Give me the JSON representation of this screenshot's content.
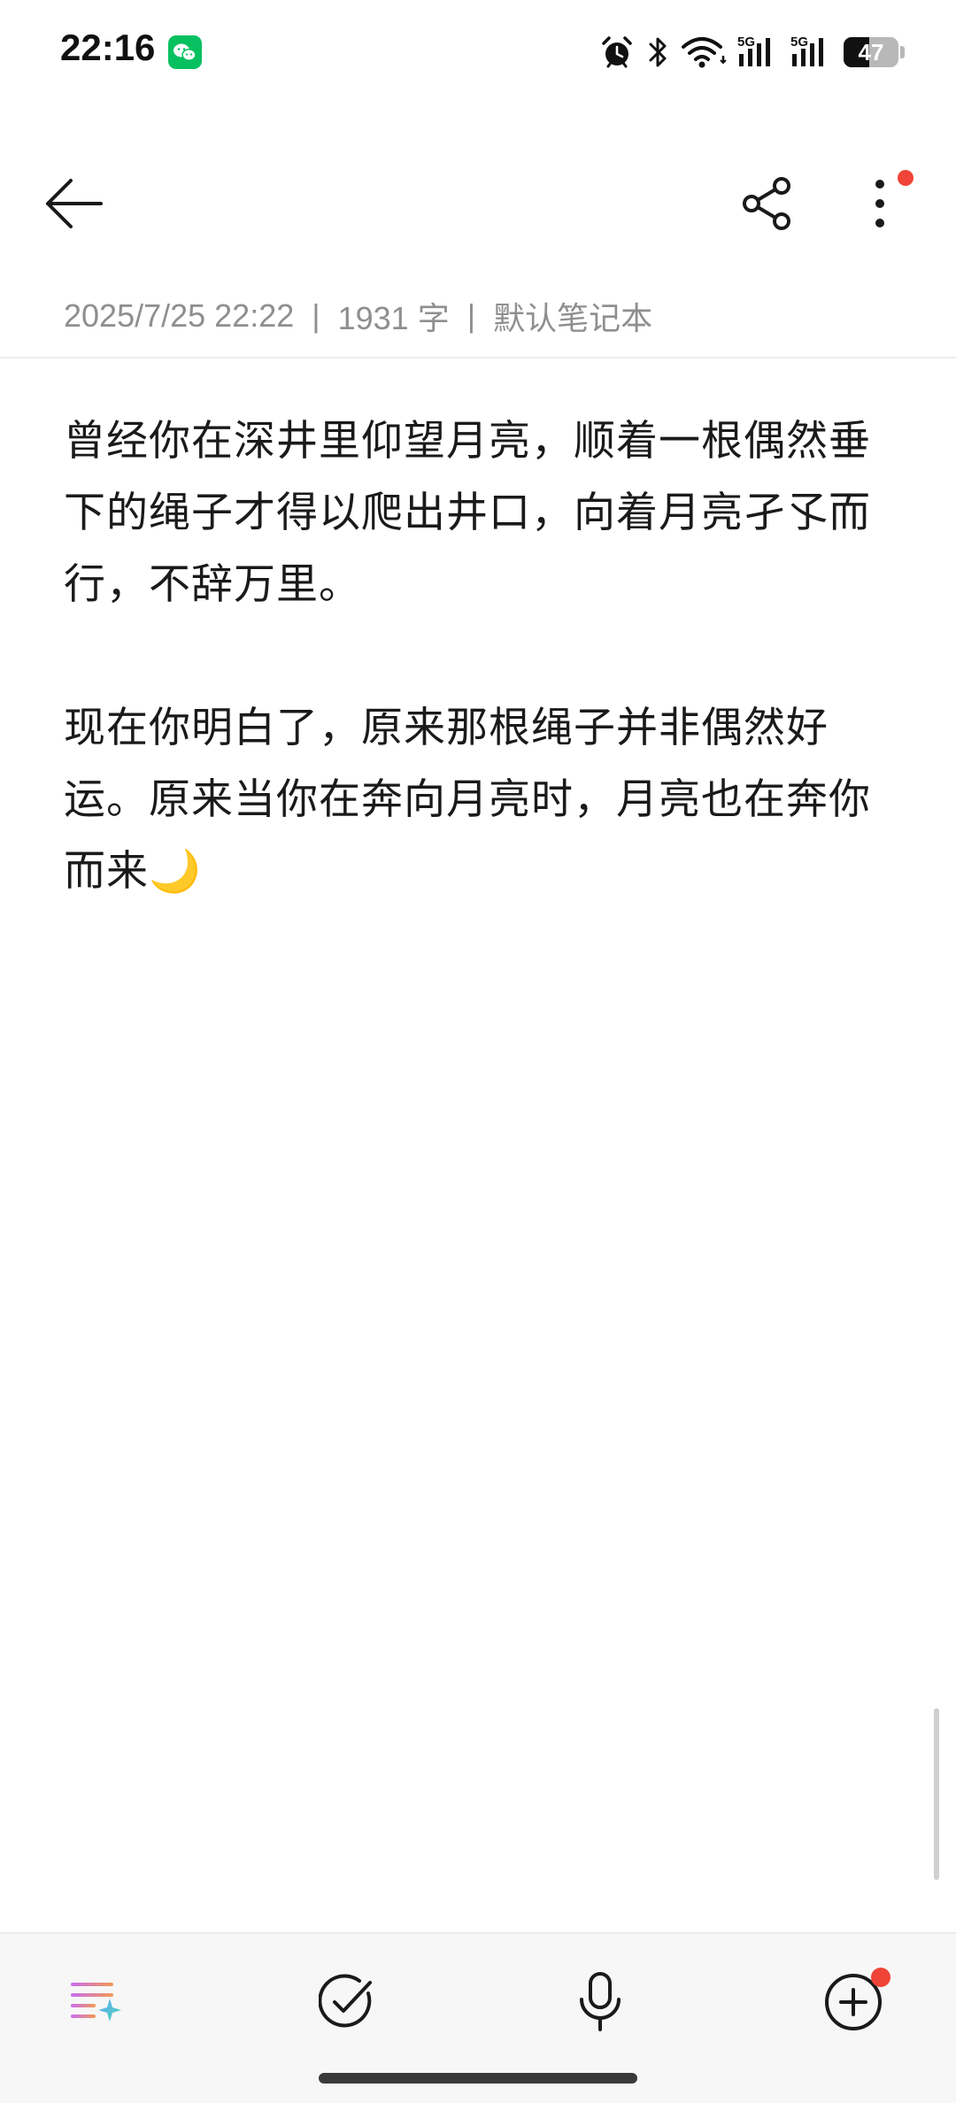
{
  "status_bar": {
    "time": "22:16",
    "notification_app_icon": "wechat-icon",
    "icons": [
      "alarm-icon",
      "bluetooth-icon",
      "wifi-icon",
      "signal-5g-icon",
      "signal-5g-icon"
    ],
    "network_label_1": "5G",
    "network_label_2": "5G",
    "battery_level": "47",
    "battery_fraction": 0.47
  },
  "toolbar": {
    "back_icon": "arrow-left-icon",
    "share_icon": "share-icon",
    "more_icon": "more-vertical-icon",
    "more_has_notification": true
  },
  "meta": {
    "datetime": "2025/7/25 22:22",
    "separator": "|",
    "word_count": "1931 字",
    "notebook": "默认笔记本"
  },
  "content": {
    "paragraphs": [
      "曾经你在深井里仰望月亮，顺着一根偶然垂下的绳子才得以爬出井口，向着月亮孑孓而行，不辞万里。",
      "现在你明白了，原来那根绳子并非偶然好运。原来当你在奔向月亮时，月亮也在奔你而来🌙"
    ]
  },
  "bottom_bar": {
    "buttons": [
      {
        "icon": "ai-format-icon"
      },
      {
        "icon": "checklist-icon"
      },
      {
        "icon": "microphone-icon"
      },
      {
        "icon": "add-icon",
        "has_notification": true
      }
    ]
  },
  "colors": {
    "accent_green": "#07c160",
    "notification_red": "#f04438",
    "meta_gray": "#8f8f8f",
    "text": "#1a1a1a"
  }
}
